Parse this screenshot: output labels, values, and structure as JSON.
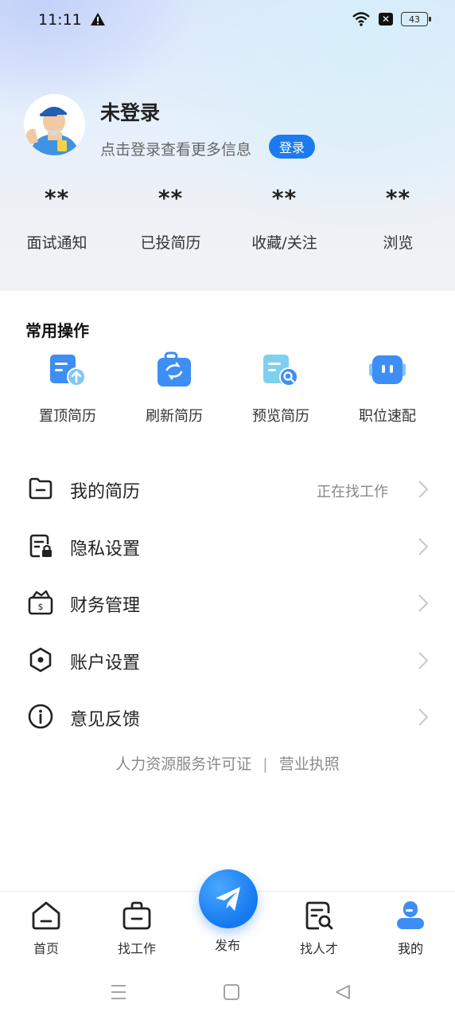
{
  "status_bar": {
    "time": "11:11",
    "battery": "43"
  },
  "profile": {
    "name": "未登录",
    "hint": "点击登录查看更多信息",
    "login_label": "登录"
  },
  "stats": [
    {
      "value": "**",
      "label": "面试通知"
    },
    {
      "value": "**",
      "label": "已投简历"
    },
    {
      "value": "**",
      "label": "收藏/关注"
    },
    {
      "value": "**",
      "label": "浏览"
    }
  ],
  "common_ops": {
    "title": "常用操作",
    "items": [
      {
        "label": "置顶简历",
        "icon": "resume-top-icon"
      },
      {
        "label": "刷新简历",
        "icon": "refresh-resume-icon"
      },
      {
        "label": "预览简历",
        "icon": "preview-resume-icon"
      },
      {
        "label": "职位速配",
        "icon": "job-match-icon"
      }
    ]
  },
  "menu": [
    {
      "label": "我的简历",
      "extra": "正在找工作",
      "icon": "folder-icon"
    },
    {
      "label": "隐私设置",
      "extra": "",
      "icon": "privacy-lock-icon"
    },
    {
      "label": "财务管理",
      "extra": "",
      "icon": "wallet-icon"
    },
    {
      "label": "账户设置",
      "extra": "",
      "icon": "hexagon-settings-icon"
    },
    {
      "label": "意见反馈",
      "extra": "",
      "icon": "info-icon"
    }
  ],
  "footer_links": {
    "license": "人力资源服务许可证",
    "separator": "|",
    "business": "营业执照"
  },
  "tabbar": {
    "home": "首页",
    "find_job": "找工作",
    "publish": "发布",
    "find_talent": "找人才",
    "mine": "我的"
  },
  "colors": {
    "accent": "#1d7af0",
    "icon_blue": "#3d8ef5"
  }
}
